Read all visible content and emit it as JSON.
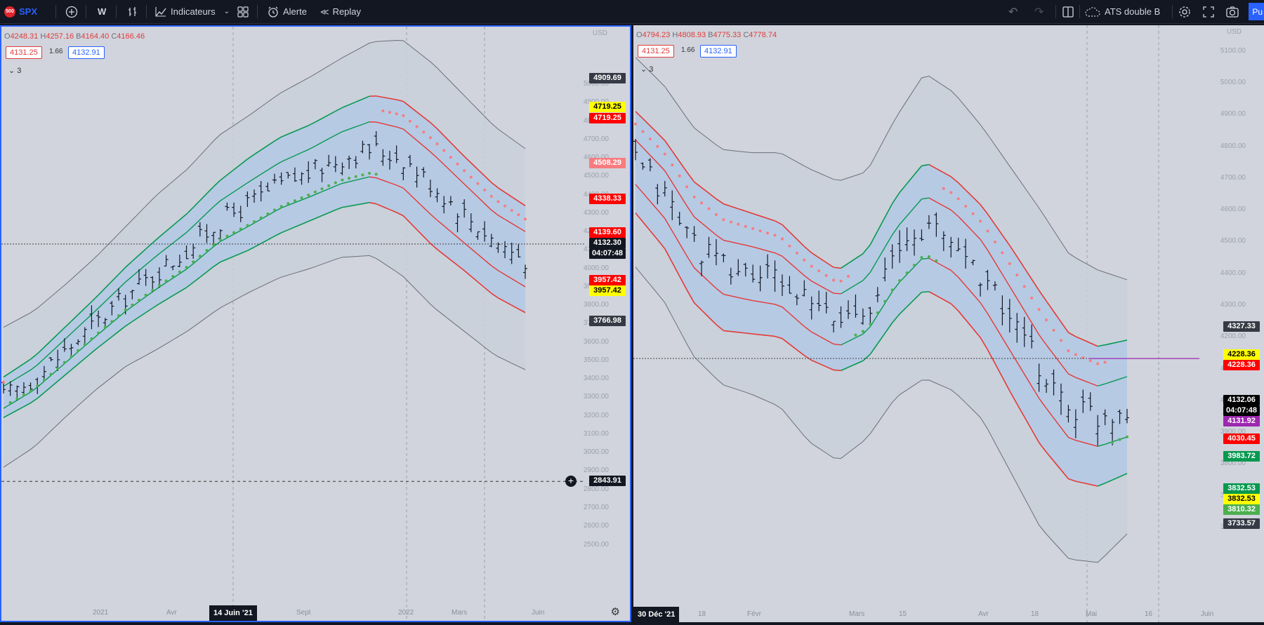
{
  "toolbar": {
    "symbol_logo": "500",
    "symbol": "SPX",
    "interval": "W",
    "indicators": "Indicateurs",
    "alert": "Alerte",
    "replay": "Replay",
    "layout_name": "ATS double B",
    "publish": "Pu",
    "icons": [
      "add-symbol-icon",
      "bar-style-icon",
      "indicators-icon",
      "layout-grid-icon",
      "alert-icon",
      "replay-icon",
      "undo-icon",
      "redo-icon",
      "split-layout-icon",
      "cloud-icon",
      "settings-icon",
      "fullscreen-icon",
      "camera-icon"
    ]
  },
  "left_chart": {
    "ohlc": {
      "o": "4248.31",
      "h": "4257.16",
      "b": "4164.40",
      "c": "4166.46"
    },
    "bid": "4131.25",
    "spread": "1.66",
    "ask": "4132.91",
    "indicators_count": "3",
    "currency": "USD",
    "y_ticks": [
      "5000.00",
      "4900.00",
      "4800.00",
      "4700.00",
      "4600.00",
      "4500.00",
      "4400.00",
      "4300.00",
      "4200.00",
      "4100.00",
      "4000.00",
      "3900.00",
      "3800.00",
      "3700.00",
      "3600.00",
      "3500.00",
      "3400.00",
      "3300.00",
      "3200.00",
      "3100.00",
      "3000.00",
      "2900.00",
      "2800.00",
      "2700.00",
      "2600.00",
      "2500.00"
    ],
    "x_ticks": [
      "2021",
      "Avr",
      "Sept",
      "2022",
      "Mars",
      "Juin"
    ],
    "crosshair_date": "14 Juin '21",
    "crosshair_price": "2843.91",
    "price_labels": [
      {
        "v": "4909.69",
        "bg": "#363a45",
        "fg": "#ffffff"
      },
      {
        "v": "4719.25",
        "bg": "#ffff00",
        "fg": "#000000"
      },
      {
        "v": "4719.25",
        "bg": "#ff0000",
        "fg": "#ffffff"
      },
      {
        "v": "4508.29",
        "bg": "#f77c80",
        "fg": "#ffffff"
      },
      {
        "v": "4338.33",
        "bg": "#ff0000",
        "fg": "#ffffff"
      },
      {
        "v": "4139.60",
        "bg": "#ff0000",
        "fg": "#ffffff"
      },
      {
        "v": "4132.30",
        "bg": "#131722",
        "fg": "#ffffff"
      },
      {
        "v": "04:07:48",
        "bg": "#131722",
        "fg": "#ffffff"
      },
      {
        "v": "3957.42",
        "bg": "#ff0000",
        "fg": "#ffffff"
      },
      {
        "v": "3957.42",
        "bg": "#ffff00",
        "fg": "#000000"
      },
      {
        "v": "3766.98",
        "bg": "#363a45",
        "fg": "#ffffff"
      }
    ]
  },
  "right_chart": {
    "ohlc": {
      "o": "4794.23",
      "h": "4808.93",
      "b": "4775.33",
      "c": "4778.74"
    },
    "bid": "4131.25",
    "spread": "1.66",
    "ask": "4132.91",
    "indicators_count": "3",
    "currency": "USD",
    "y_ticks": [
      "5100.00",
      "5000.00",
      "4900.00",
      "4800.00",
      "4700.00",
      "4600.00",
      "4500.00",
      "4400.00",
      "4300.00",
      "4200.00",
      "4100.00",
      "4000.00",
      "3900.00",
      "3800.00",
      "3700.00",
      "3600.00"
    ],
    "x_ticks": [
      "18",
      "Févr",
      "Mars",
      "15",
      "Avr",
      "18",
      "Mai",
      "16",
      "Juin"
    ],
    "crosshair_date": "30 Déc '21",
    "price_labels": [
      {
        "v": "4327.33",
        "bg": "#363a45",
        "fg": "#ffffff"
      },
      {
        "v": "4228.36",
        "bg": "#ffff00",
        "fg": "#000000"
      },
      {
        "v": "4228.36",
        "bg": "#ff0000",
        "fg": "#ffffff"
      },
      {
        "v": "4132.06",
        "bg": "#000000",
        "fg": "#ffffff"
      },
      {
        "v": "04:07:48",
        "bg": "#000000",
        "fg": "#ffffff"
      },
      {
        "v": "4131.92",
        "bg": "#9c27b0",
        "fg": "#ffffff"
      },
      {
        "v": "4030.45",
        "bg": "#ff0000",
        "fg": "#ffffff"
      },
      {
        "v": "3983.72",
        "bg": "#089950",
        "fg": "#ffffff"
      },
      {
        "v": "3832.53",
        "bg": "#089950",
        "fg": "#ffffff"
      },
      {
        "v": "3832.53",
        "bg": "#ffff00",
        "fg": "#000000"
      },
      {
        "v": "3810.32",
        "bg": "#4caf50",
        "fg": "#ffffff"
      },
      {
        "v": "3733.57",
        "bg": "#363a45",
        "fg": "#ffffff"
      }
    ]
  },
  "colors": {
    "accent": "#2962ff",
    "up": "#089981",
    "down": "#f23645",
    "band_fill": "#bbd0ea",
    "pane_bg": "#d1d4dc"
  }
}
